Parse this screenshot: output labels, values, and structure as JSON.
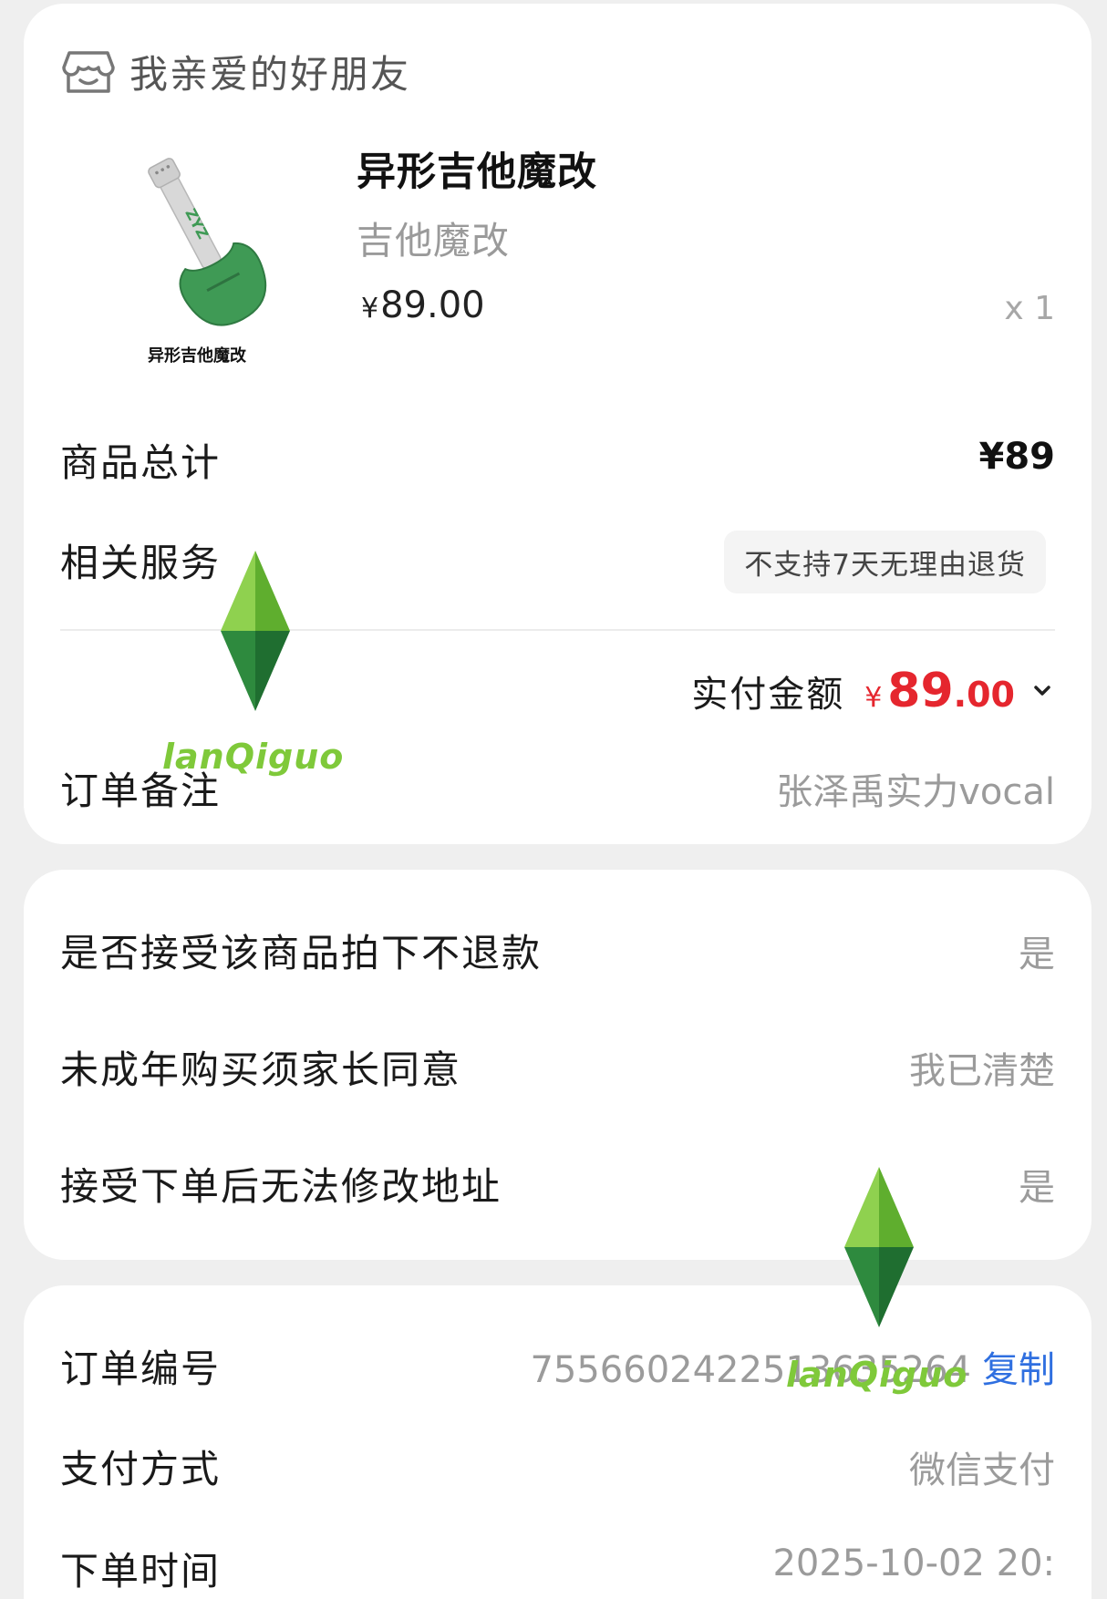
{
  "shop": {
    "name": "我亲爱的好朋友",
    "icon": "shop-icon"
  },
  "product": {
    "title": "异形吉他魔改",
    "sku": "吉他魔改",
    "price_symbol": "¥",
    "price": "89.00",
    "quantity": "x 1",
    "image_caption": "异形吉他魔改",
    "image_letters": "ZYZ",
    "accent_color": "#3f9a55"
  },
  "summary": {
    "total_label": "商品总计",
    "total_value": "¥89",
    "service_label": "相关服务",
    "service_badge": "不支持7天无理由退货",
    "paid_label": "实付金额",
    "paid_symbol": "¥",
    "paid_int": "89",
    "paid_dec": ".00",
    "paid_color": "#e5262e",
    "remark_label": "订单备注",
    "remark_value": "张泽禹实力vocal"
  },
  "agreements": [
    {
      "label": "是否接受该商品拍下不退款",
      "value": "是"
    },
    {
      "label": "未成年购买须家长同意",
      "value": "我已清楚"
    },
    {
      "label": "接受下单后无法修改地址",
      "value": "是"
    }
  ],
  "order_info": {
    "order_no_label": "订单编号",
    "order_no_value": "7556602422513635264",
    "copy_label": "复制",
    "pay_method_label": "支付方式",
    "pay_method_value": "微信支付",
    "order_time_label": "下单时间",
    "order_time_value": "2025-10-02 20:"
  },
  "watermark": {
    "text": "lanQiguo",
    "color": "#7fc93a"
  }
}
